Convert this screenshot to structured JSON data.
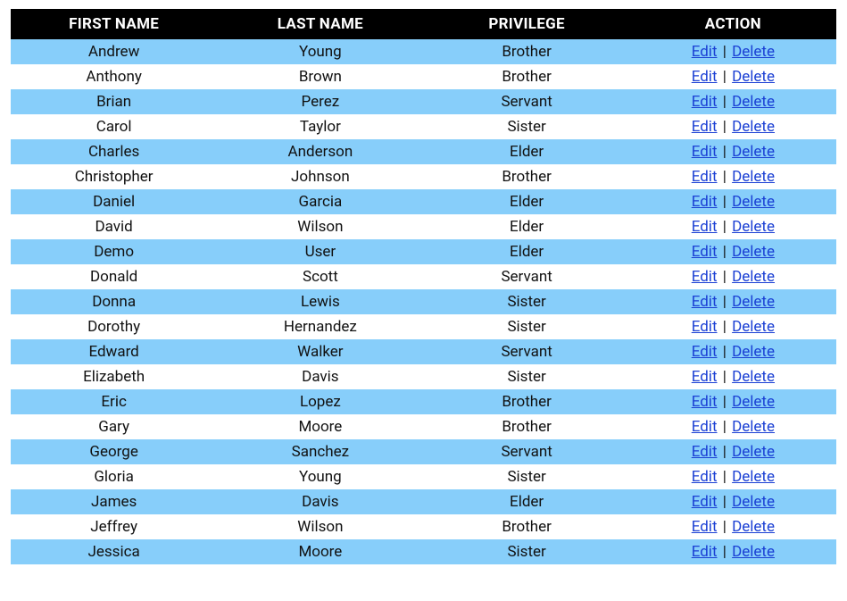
{
  "table": {
    "headers": {
      "first_name": "FIRST NAME",
      "last_name": "LAST NAME",
      "privilege": "PRIVILEGE",
      "action": "ACTION"
    },
    "actions": {
      "edit": "Edit",
      "delete": "Delete",
      "separator": "|"
    },
    "rows": [
      {
        "first_name": "Andrew",
        "last_name": "Young",
        "privilege": "Brother"
      },
      {
        "first_name": "Anthony",
        "last_name": "Brown",
        "privilege": "Brother"
      },
      {
        "first_name": "Brian",
        "last_name": "Perez",
        "privilege": "Servant"
      },
      {
        "first_name": "Carol",
        "last_name": "Taylor",
        "privilege": "Sister"
      },
      {
        "first_name": "Charles",
        "last_name": "Anderson",
        "privilege": "Elder"
      },
      {
        "first_name": "Christopher",
        "last_name": "Johnson",
        "privilege": "Brother"
      },
      {
        "first_name": "Daniel",
        "last_name": "Garcia",
        "privilege": "Elder"
      },
      {
        "first_name": "David",
        "last_name": "Wilson",
        "privilege": "Elder"
      },
      {
        "first_name": "Demo",
        "last_name": "User",
        "privilege": "Elder"
      },
      {
        "first_name": "Donald",
        "last_name": "Scott",
        "privilege": "Servant"
      },
      {
        "first_name": "Donna",
        "last_name": "Lewis",
        "privilege": "Sister"
      },
      {
        "first_name": "Dorothy",
        "last_name": "Hernandez",
        "privilege": "Sister"
      },
      {
        "first_name": "Edward",
        "last_name": "Walker",
        "privilege": "Servant"
      },
      {
        "first_name": "Elizabeth",
        "last_name": "Davis",
        "privilege": "Sister"
      },
      {
        "first_name": "Eric",
        "last_name": "Lopez",
        "privilege": "Brother"
      },
      {
        "first_name": "Gary",
        "last_name": "Moore",
        "privilege": "Brother"
      },
      {
        "first_name": "George",
        "last_name": "Sanchez",
        "privilege": "Servant"
      },
      {
        "first_name": "Gloria",
        "last_name": "Young",
        "privilege": "Sister"
      },
      {
        "first_name": "James",
        "last_name": "Davis",
        "privilege": "Elder"
      },
      {
        "first_name": "Jeffrey",
        "last_name": "Wilson",
        "privilege": "Brother"
      },
      {
        "first_name": "Jessica",
        "last_name": "Moore",
        "privilege": "Sister"
      }
    ]
  }
}
